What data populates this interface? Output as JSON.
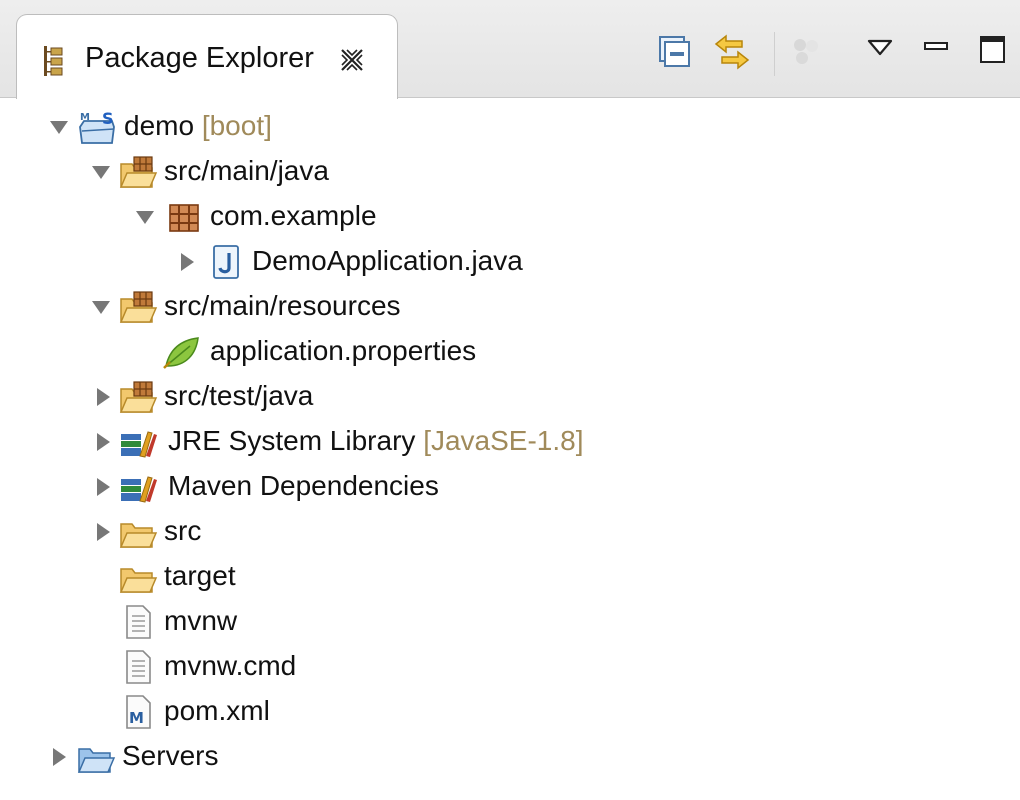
{
  "view": {
    "title": "Package Explorer",
    "close_icon": "close-x-icon",
    "toolbar": [
      {
        "name": "collapse-all-icon"
      },
      {
        "name": "link-with-editor-icon"
      },
      {
        "name": "focus-on-active-task-icon",
        "disabled": true
      },
      {
        "name": "view-menu-triangle-icon"
      },
      {
        "name": "minimize-icon"
      },
      {
        "name": "maximize-icon"
      }
    ]
  },
  "tree": [
    {
      "id": "demo",
      "label": "demo",
      "decoration": "[boot]",
      "icon": "boot-maven-project-icon",
      "expanded": true
    },
    {
      "id": "src-main-java",
      "label": "src/main/java",
      "icon": "source-folder-icon",
      "expanded": true
    },
    {
      "id": "com-example",
      "label": "com.example",
      "icon": "package-icon",
      "expanded": true
    },
    {
      "id": "demo-application-java",
      "label": "DemoApplication.java",
      "icon": "java-file-icon",
      "expanded": false
    },
    {
      "id": "src-main-resources",
      "label": "src/main/resources",
      "icon": "source-folder-icon",
      "expanded": true
    },
    {
      "id": "application-properties",
      "label": "application.properties",
      "icon": "spring-leaf-icon"
    },
    {
      "id": "src-test-java",
      "label": "src/test/java",
      "icon": "source-folder-icon",
      "expanded": false
    },
    {
      "id": "jre-system-library",
      "label": "JRE System Library",
      "decoration": "[JavaSE-1.8]",
      "icon": "library-icon",
      "expanded": false
    },
    {
      "id": "maven-dependencies",
      "label": "Maven Dependencies",
      "icon": "library-icon",
      "expanded": false
    },
    {
      "id": "src",
      "label": "src",
      "icon": "folder-icon",
      "expanded": false
    },
    {
      "id": "target",
      "label": "target",
      "icon": "folder-icon"
    },
    {
      "id": "mvnw",
      "label": "mvnw",
      "icon": "text-file-icon"
    },
    {
      "id": "mvnw-cmd",
      "label": "mvnw.cmd",
      "icon": "text-file-icon"
    },
    {
      "id": "pom-xml",
      "label": "pom.xml",
      "icon": "maven-pom-icon"
    },
    {
      "id": "servers",
      "label": "Servers",
      "icon": "project-folder-icon",
      "expanded": false
    }
  ],
  "colors": {
    "decoration": "#a08a5a",
    "folder": "#f2c86d",
    "package": "#8b4513"
  }
}
